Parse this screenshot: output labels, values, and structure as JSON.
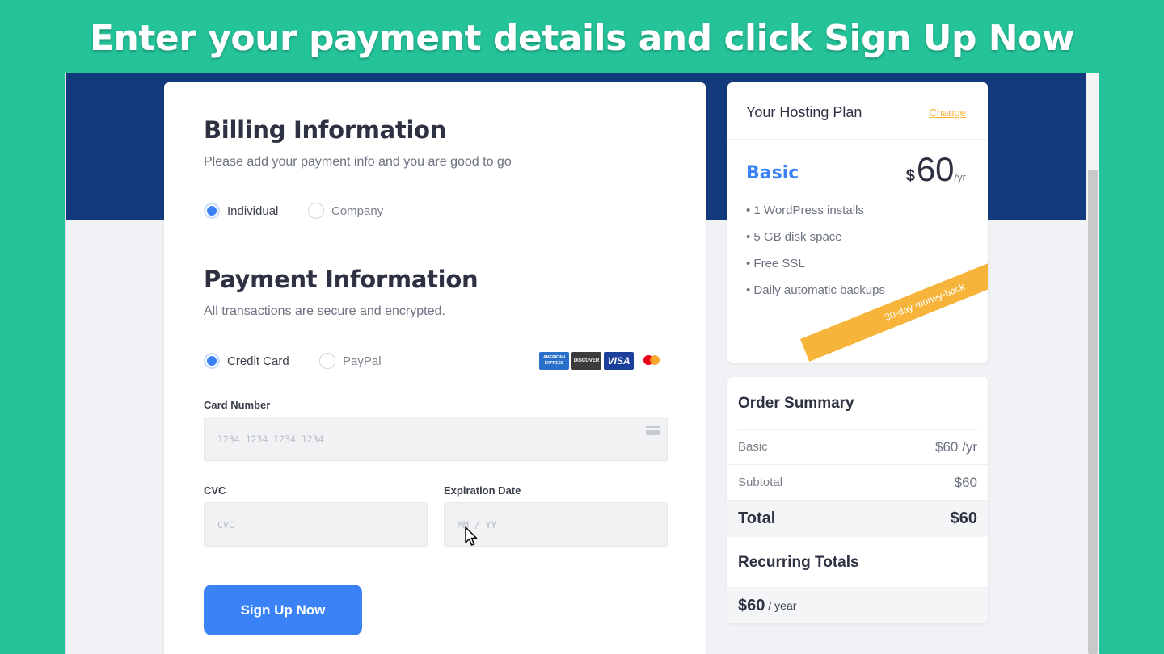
{
  "banner": "Enter your payment details and click Sign Up Now",
  "billing": {
    "title": "Billing Information",
    "subtitle": "Please add your payment info and you are good to go",
    "options": [
      "Individual",
      "Company"
    ],
    "selected": "Individual"
  },
  "payment": {
    "title": "Payment Information",
    "subtitle": "All transactions are secure and encrypted.",
    "options": [
      "Credit Card",
      "PayPal"
    ],
    "selected": "Credit Card",
    "card_logos": [
      "AMERICAN EXPRESS",
      "DISCOVER",
      "VISA",
      "mastercard"
    ],
    "card_number_label": "Card Number",
    "card_number_placeholder": "1234  1234  1234  1234",
    "cvc_label": "CVC",
    "cvc_placeholder": "CVC",
    "expiry_label": "Expiration Date",
    "expiry_placeholder": "MM  /  YY",
    "submit_label": "Sign Up Now"
  },
  "plan": {
    "title": "Your Hosting Plan",
    "change_label": "Change",
    "name": "Basic",
    "currency": "$",
    "price": "60",
    "period": "/yr",
    "features": [
      "• 1 WordPress installs",
      "• 5 GB disk space",
      "• Free SSL",
      "• Daily automatic backups"
    ],
    "ribbon": "30-day money-back"
  },
  "summary": {
    "title": "Order Summary",
    "rows": [
      {
        "label": "Basic",
        "value": "$60 /yr"
      },
      {
        "label": "Subtotal",
        "value": "$60"
      }
    ],
    "total_label": "Total",
    "total_value": "$60",
    "recurring_title": "Recurring Totals",
    "recurring_amount": "$60",
    "recurring_period": "/ year"
  },
  "colors": {
    "accent": "#3b82f6",
    "navy": "#133a7c",
    "background": "#25c39a",
    "ribbon": "#f7b43a"
  }
}
